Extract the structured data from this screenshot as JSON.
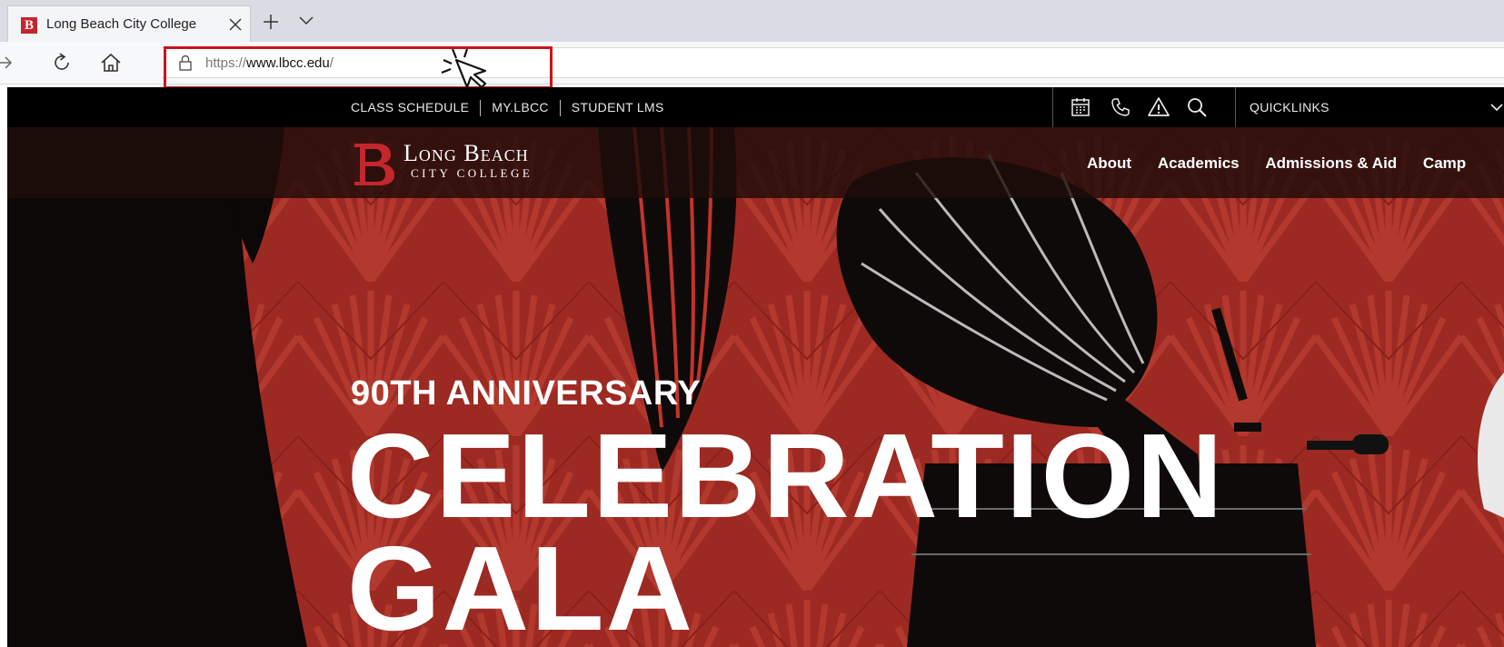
{
  "browser": {
    "tab_title": "Long Beach City College",
    "address_scheme": "https://",
    "address_host": "www.lbcc.edu",
    "address_path": "/"
  },
  "utility_bar": {
    "links": [
      "CLASS SCHEDULE",
      "MY.LBCC",
      "STUDENT LMS"
    ],
    "icons": [
      "calendar-icon",
      "phone-icon",
      "alert-icon",
      "search-icon"
    ],
    "quicklinks_label": "QUICKLINKS"
  },
  "site_header": {
    "logo_line1": "Long Beach",
    "logo_line2": "CITY COLLEGE",
    "nav": [
      "About",
      "Academics",
      "Admissions & Aid",
      "Camp"
    ]
  },
  "hero": {
    "subtitle": "90TH ANNIVERSARY",
    "title_line1": "CELEBRATION",
    "title_line2": "GALA"
  },
  "colors": {
    "brand_red": "#c4262e",
    "hero_red": "#9c2a22",
    "highlight_red": "#d0121b"
  }
}
